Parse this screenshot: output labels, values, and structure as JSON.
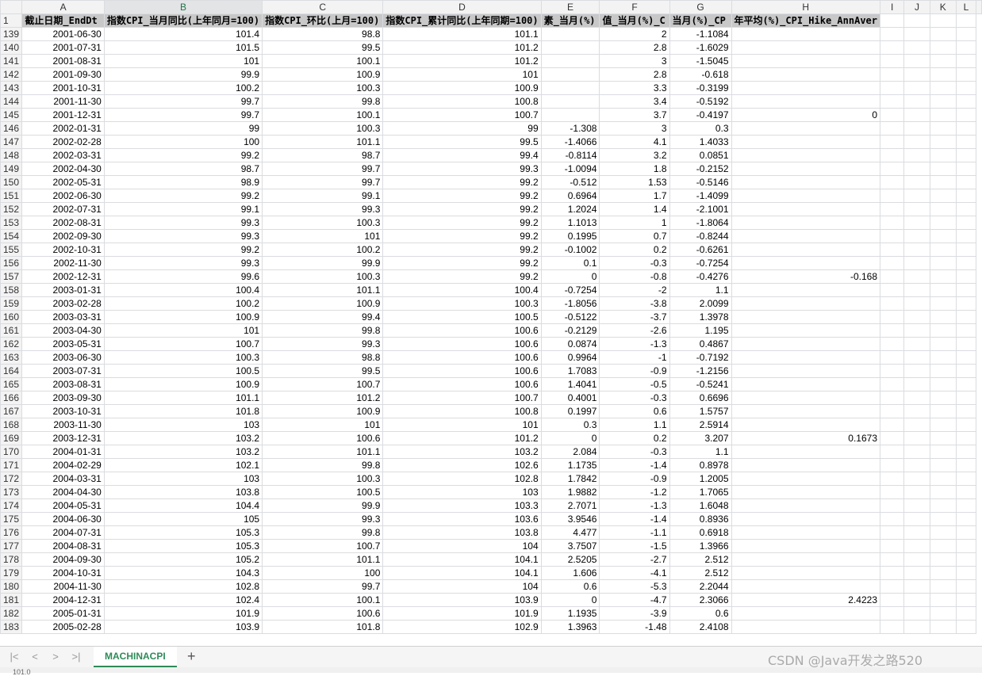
{
  "columns": [
    "A",
    "B",
    "C",
    "D",
    "E",
    "F",
    "G",
    "H",
    "I",
    "J",
    "K",
    "L"
  ],
  "selected_column": "B",
  "header_row": {
    "row_number": "1",
    "cells": [
      "截止日期_EndDt",
      "指数CPI_当月同比(上年同月=100)",
      "指数CPI_环比(上月=100)",
      "指数CPI_累计同比(上年同期=100)",
      "素_当月(%)",
      "值_当月(%)_C",
      "当月(%)_CP",
      "年平均(%)_CPI_Hike_AnnAver"
    ]
  },
  "rows": [
    [
      "139",
      "2001-06-30",
      "101.4",
      "98.8",
      "101.1",
      "",
      "2",
      "-1.1084",
      ""
    ],
    [
      "140",
      "2001-07-31",
      "101.5",
      "99.5",
      "101.2",
      "",
      "2.8",
      "-1.6029",
      ""
    ],
    [
      "141",
      "2001-08-31",
      "101",
      "100.1",
      "101.2",
      "",
      "3",
      "-1.5045",
      ""
    ],
    [
      "142",
      "2001-09-30",
      "99.9",
      "100.9",
      "101",
      "",
      "2.8",
      "-0.618",
      ""
    ],
    [
      "143",
      "2001-10-31",
      "100.2",
      "100.3",
      "100.9",
      "",
      "3.3",
      "-0.3199",
      ""
    ],
    [
      "144",
      "2001-11-30",
      "99.7",
      "99.8",
      "100.8",
      "",
      "3.4",
      "-0.5192",
      ""
    ],
    [
      "145",
      "2001-12-31",
      "99.7",
      "100.1",
      "100.7",
      "",
      "3.7",
      "-0.4197",
      "0"
    ],
    [
      "146",
      "2002-01-31",
      "99",
      "100.3",
      "99",
      "-1.308",
      "3",
      "0.3",
      ""
    ],
    [
      "147",
      "2002-02-28",
      "100",
      "101.1",
      "99.5",
      "-1.4066",
      "4.1",
      "1.4033",
      ""
    ],
    [
      "148",
      "2002-03-31",
      "99.2",
      "98.7",
      "99.4",
      "-0.8114",
      "3.2",
      "0.0851",
      ""
    ],
    [
      "149",
      "2002-04-30",
      "98.7",
      "99.7",
      "99.3",
      "-1.0094",
      "1.8",
      "-0.2152",
      ""
    ],
    [
      "150",
      "2002-05-31",
      "98.9",
      "99.7",
      "99.2",
      "-0.512",
      "1.53",
      "-0.5146",
      ""
    ],
    [
      "151",
      "2002-06-30",
      "99.2",
      "99.1",
      "99.2",
      "0.6964",
      "1.7",
      "-1.4099",
      ""
    ],
    [
      "152",
      "2002-07-31",
      "99.1",
      "99.3",
      "99.2",
      "1.2024",
      "1.4",
      "-2.1001",
      ""
    ],
    [
      "153",
      "2002-08-31",
      "99.3",
      "100.3",
      "99.2",
      "1.1013",
      "1",
      "-1.8064",
      ""
    ],
    [
      "154",
      "2002-09-30",
      "99.3",
      "101",
      "99.2",
      "0.1995",
      "0.7",
      "-0.8244",
      ""
    ],
    [
      "155",
      "2002-10-31",
      "99.2",
      "100.2",
      "99.2",
      "-0.1002",
      "0.2",
      "-0.6261",
      ""
    ],
    [
      "156",
      "2002-11-30",
      "99.3",
      "99.9",
      "99.2",
      "0.1",
      "-0.3",
      "-0.7254",
      ""
    ],
    [
      "157",
      "2002-12-31",
      "99.6",
      "100.3",
      "99.2",
      "0",
      "-0.8",
      "-0.4276",
      "-0.168"
    ],
    [
      "158",
      "2003-01-31",
      "100.4",
      "101.1",
      "100.4",
      "-0.7254",
      "-2",
      "1.1",
      ""
    ],
    [
      "159",
      "2003-02-28",
      "100.2",
      "100.9",
      "100.3",
      "-1.8056",
      "-3.8",
      "2.0099",
      ""
    ],
    [
      "160",
      "2003-03-31",
      "100.9",
      "99.4",
      "100.5",
      "-0.5122",
      "-3.7",
      "1.3978",
      ""
    ],
    [
      "161",
      "2003-04-30",
      "101",
      "99.8",
      "100.6",
      "-0.2129",
      "-2.6",
      "1.195",
      ""
    ],
    [
      "162",
      "2003-05-31",
      "100.7",
      "99.3",
      "100.6",
      "0.0874",
      "-1.3",
      "0.4867",
      ""
    ],
    [
      "163",
      "2003-06-30",
      "100.3",
      "98.8",
      "100.6",
      "0.9964",
      "-1",
      "-0.7192",
      ""
    ],
    [
      "164",
      "2003-07-31",
      "100.5",
      "99.5",
      "100.6",
      "1.7083",
      "-0.9",
      "-1.2156",
      ""
    ],
    [
      "165",
      "2003-08-31",
      "100.9",
      "100.7",
      "100.6",
      "1.4041",
      "-0.5",
      "-0.5241",
      ""
    ],
    [
      "166",
      "2003-09-30",
      "101.1",
      "101.2",
      "100.7",
      "0.4001",
      "-0.3",
      "0.6696",
      ""
    ],
    [
      "167",
      "2003-10-31",
      "101.8",
      "100.9",
      "100.8",
      "0.1997",
      "0.6",
      "1.5757",
      ""
    ],
    [
      "168",
      "2003-11-30",
      "103",
      "101",
      "101",
      "0.3",
      "1.1",
      "2.5914",
      ""
    ],
    [
      "169",
      "2003-12-31",
      "103.2",
      "100.6",
      "101.2",
      "0",
      "0.2",
      "3.207",
      "0.1673"
    ],
    [
      "170",
      "2004-01-31",
      "103.2",
      "101.1",
      "103.2",
      "2.084",
      "-0.3",
      "1.1",
      ""
    ],
    [
      "171",
      "2004-02-29",
      "102.1",
      "99.8",
      "102.6",
      "1.1735",
      "-1.4",
      "0.8978",
      ""
    ],
    [
      "172",
      "2004-03-31",
      "103",
      "100.3",
      "102.8",
      "1.7842",
      "-0.9",
      "1.2005",
      ""
    ],
    [
      "173",
      "2004-04-30",
      "103.8",
      "100.5",
      "103",
      "1.9882",
      "-1.2",
      "1.7065",
      ""
    ],
    [
      "174",
      "2004-05-31",
      "104.4",
      "99.9",
      "103.3",
      "2.7071",
      "-1.3",
      "1.6048",
      ""
    ],
    [
      "175",
      "2004-06-30",
      "105",
      "99.3",
      "103.6",
      "3.9546",
      "-1.4",
      "0.8936",
      ""
    ],
    [
      "176",
      "2004-07-31",
      "105.3",
      "99.8",
      "103.8",
      "4.477",
      "-1.1",
      "0.6918",
      ""
    ],
    [
      "177",
      "2004-08-31",
      "105.3",
      "100.7",
      "104",
      "3.7507",
      "-1.5",
      "1.3966",
      ""
    ],
    [
      "178",
      "2004-09-30",
      "105.2",
      "101.1",
      "104.1",
      "2.5205",
      "-2.7",
      "2.512",
      ""
    ],
    [
      "179",
      "2004-10-31",
      "104.3",
      "100",
      "104.1",
      "1.606",
      "-4.1",
      "2.512",
      ""
    ],
    [
      "180",
      "2004-11-30",
      "102.8",
      "99.7",
      "104",
      "0.6",
      "-5.3",
      "2.2044",
      ""
    ],
    [
      "181",
      "2004-12-31",
      "102.4",
      "100.1",
      "103.9",
      "0",
      "-4.7",
      "2.3066",
      "2.4223"
    ],
    [
      "182",
      "2005-01-31",
      "101.9",
      "100.6",
      "101.9",
      "1.1935",
      "-3.9",
      "0.6",
      ""
    ],
    [
      "183",
      "2005-02-28",
      "103.9",
      "101.8",
      "102.9",
      "1.3963",
      "-1.48",
      "2.4108",
      ""
    ]
  ],
  "sheet_tab": "MACHINACPI",
  "nav": {
    "first": "|<",
    "prev": "<",
    "next": ">",
    "last": ">|",
    "add": "+"
  },
  "watermark": "CSDN @Java开发之路520",
  "status": "101.0",
  "colors": {
    "accent": "#2e8b57",
    "header_bg": "#c8c8c8"
  }
}
